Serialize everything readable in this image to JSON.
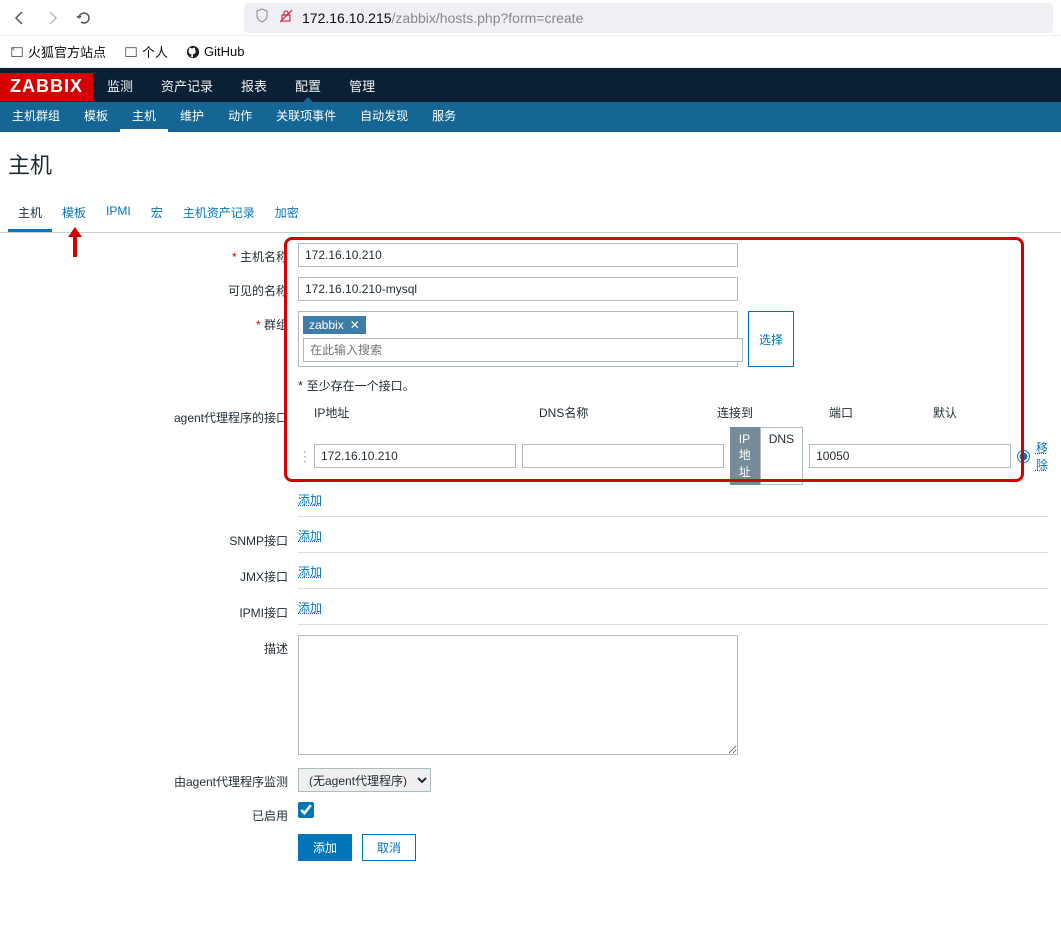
{
  "browser": {
    "url_host": "172.16.10.215",
    "url_path": "/zabbix/hosts.php?form=create",
    "bookmarks": [
      {
        "label": "火狐官方站点",
        "icon": "folder"
      },
      {
        "label": "个人",
        "icon": "folder"
      },
      {
        "label": "GitHub",
        "icon": "github"
      }
    ]
  },
  "header": {
    "logo": "ZABBIX",
    "menu": [
      "监测",
      "资产记录",
      "报表",
      "配置",
      "管理"
    ],
    "menu_active": "配置",
    "submenu": [
      "主机群组",
      "模板",
      "主机",
      "维护",
      "动作",
      "关联项事件",
      "自动发现",
      "服务"
    ],
    "submenu_active": "主机"
  },
  "page": {
    "title": "主机",
    "tabs": [
      "主机",
      "模板",
      "IPMI",
      "宏",
      "主机资产记录",
      "加密"
    ],
    "tab_active": "主机"
  },
  "form": {
    "hostname_label": "主机名称",
    "hostname_value": "172.16.10.210",
    "visiblename_label": "可见的名称",
    "visiblename_value": "172.16.10.210-mysql",
    "groups_label": "群组",
    "groups_tag": "zabbix",
    "groups_placeholder": "在此输入搜索",
    "select_btn": "选择",
    "interface_error": "至少存在一个接口。",
    "agent_label": "agent代理程序的接口",
    "iface_headers": {
      "ip": "IP地址",
      "dns": "DNS名称",
      "connect": "连接到",
      "port": "端口",
      "default": "默认"
    },
    "agent_iface": {
      "ip": "172.16.10.210",
      "dns": "",
      "connect_ip": "IP地址",
      "connect_dns": "DNS",
      "port": "10050",
      "remove": "移除"
    },
    "add_link": "添加",
    "snmp_label": "SNMP接口",
    "jmx_label": "JMX接口",
    "ipmi_label": "IPMI接口",
    "description_label": "描述",
    "proxy_label": "由agent代理程序监测",
    "proxy_value": "(无agent代理程序)",
    "enabled_label": "已启用",
    "enabled_checked": true,
    "submit_btn": "添加",
    "cancel_btn": "取消"
  }
}
